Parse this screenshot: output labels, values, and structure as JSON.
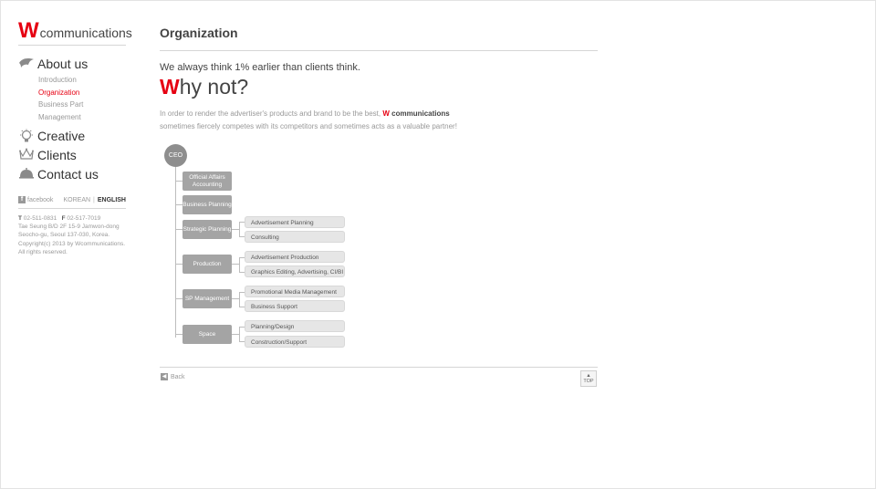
{
  "logo": {
    "mark": "W",
    "text": "communications"
  },
  "nav": {
    "about": {
      "label": "About us",
      "icon": "bird-icon"
    },
    "about_sub": [
      "Introduction",
      "Organization",
      "Business Part",
      "Management"
    ],
    "creative": {
      "label": "Creative",
      "icon": "lightbulb-icon"
    },
    "clients": {
      "label": "Clients",
      "icon": "crown-icon"
    },
    "contact": {
      "label": "Contact us",
      "icon": "bell-icon"
    }
  },
  "social": {
    "facebook": "facebook"
  },
  "lang": {
    "korean": "KOREAN",
    "english": "ENGLISH"
  },
  "contact_info": {
    "t_label": "T",
    "phone": "02-511-0831",
    "f_label": "F",
    "fax": "02-517-7019",
    "address1": "Tae Seung B/D 2F 15-9 Jamwon-dong",
    "address2": "Seocho-gu, Seoul 137-030, Korea.",
    "copyright": "Copyright(c) 2013 by Wcommunications.",
    "rights": "All rights reserved."
  },
  "main": {
    "title": "Organization",
    "tagline": "We always think 1% earlier than clients think.",
    "why_w": "W",
    "why_rest": "hy not?",
    "desc_pre": "In order to render the advertiser's products and brand to be the best, ",
    "desc_brand_w": "W",
    "desc_brand": " communications",
    "desc_post": "sometimes fiercely competes with its competitors and sometimes acts as a valuable partner!"
  },
  "org": {
    "ceo": "CEO",
    "depts": [
      {
        "name": "Official Affairs Accounting",
        "subs": []
      },
      {
        "name": "Business Planning",
        "subs": []
      },
      {
        "name": "Strategic Planning",
        "subs": [
          "Advertisement Planning",
          "Consulting"
        ]
      },
      {
        "name": "Production",
        "subs": [
          "Advertisement Production",
          "Graphics Editing, Advertising, CI/BI"
        ]
      },
      {
        "name": "SP Management",
        "subs": [
          "Promotional Media Management",
          "Business Support"
        ]
      },
      {
        "name": "Space",
        "subs": [
          "Planning/Design",
          "Construction/Support"
        ]
      }
    ]
  },
  "footer": {
    "back": "Back",
    "top": "TOP"
  },
  "colors": {
    "accent": "#e60012",
    "dept": "#a4a4a4",
    "sub": "#e6e6e6"
  }
}
